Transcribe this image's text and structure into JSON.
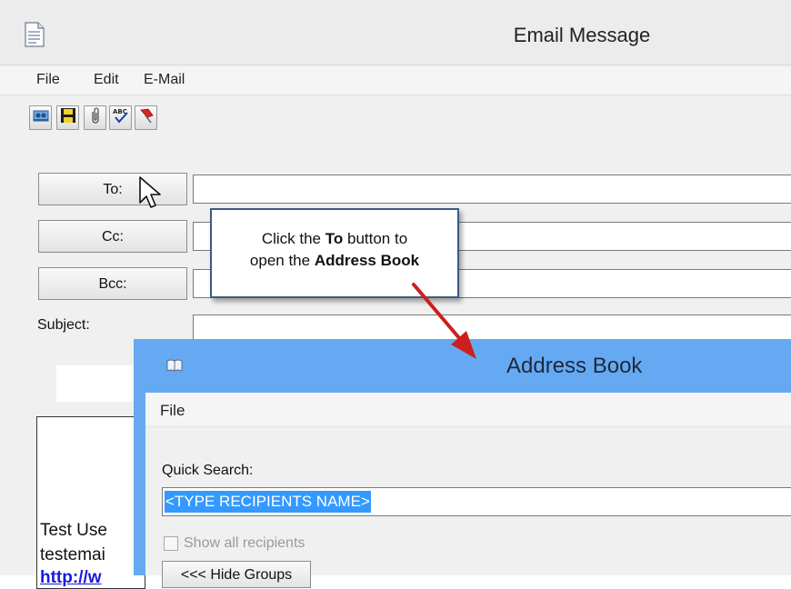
{
  "email_window": {
    "title": "Email Message",
    "menu": [
      "File",
      "Edit",
      "E-Mail"
    ],
    "toolbar": {
      "icons": [
        "address-book-icon",
        "save-icon",
        "attachment-icon",
        "spellcheck-icon",
        "pin-icon"
      ]
    },
    "to_button": "To:",
    "cc_button": "Cc:",
    "bcc_button": "Bcc:",
    "subject_label": "Subject:",
    "body_lines": [
      "Test Use",
      "testemai",
      "http://w"
    ]
  },
  "callout": {
    "part1": "Click the ",
    "bold1": "To",
    "part2": " button to",
    "part3": "open the ",
    "bold2": "Address Book"
  },
  "address_book": {
    "title": "Address Book",
    "menu_file": "File",
    "quick_search_label": "Quick Search:",
    "quick_search_value": "<TYPE RECIPIENTS NAME>",
    "show_all_label": "Show all recipients",
    "show_all_checked": false,
    "hide_groups_label": "<<< Hide Groups"
  },
  "colors": {
    "address_book_frame": "#66a9f3",
    "selection": "#3399ff",
    "callout_border": "#3b5a86",
    "arrow": "#cc1f1f",
    "link": "#1a1adc"
  }
}
